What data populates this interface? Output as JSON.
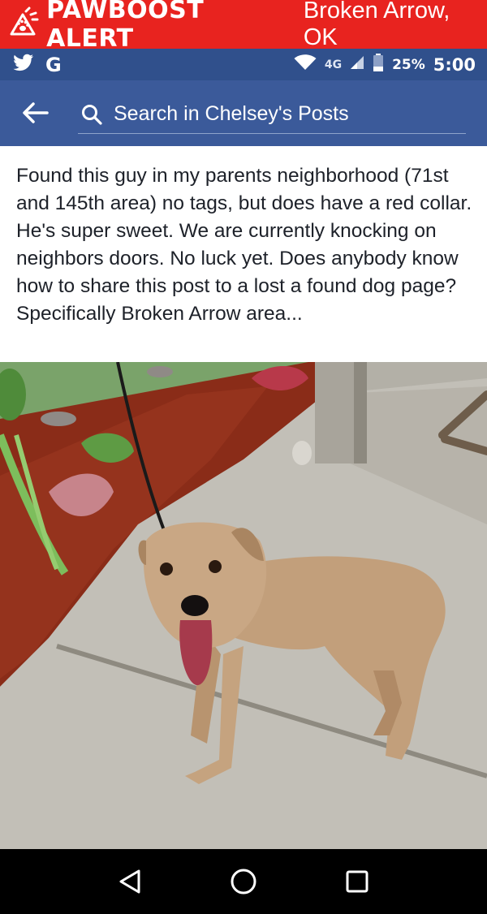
{
  "banner": {
    "brand": "PAWBOOST ALERT",
    "location": "Broken Arrow, OK",
    "color": "#e8231f"
  },
  "statusbar": {
    "icons": [
      "twitter-icon",
      "google-icon",
      "wifi-icon",
      "signal-icon",
      "battery-icon"
    ],
    "google_letter": "G",
    "network": "4G",
    "battery": "25%",
    "time": "5:00",
    "color": "#30508c"
  },
  "header": {
    "search_placeholder": "Search in Chelsey's Posts",
    "color": "#3b5a9a"
  },
  "post": {
    "text": "Found this guy in my parents neighborhood (71st and 145th area) no tags, but does have a red collar. He's super sweet. We are currently knocking on neighbors doors. No luck yet. Does anybody know how to share this post to a lost a found dog page? Specifically Broken Arrow area..."
  },
  "photo": {
    "subject": "dog-photo"
  },
  "navbar": {
    "buttons": [
      "back-icon",
      "home-icon",
      "recents-icon"
    ]
  }
}
